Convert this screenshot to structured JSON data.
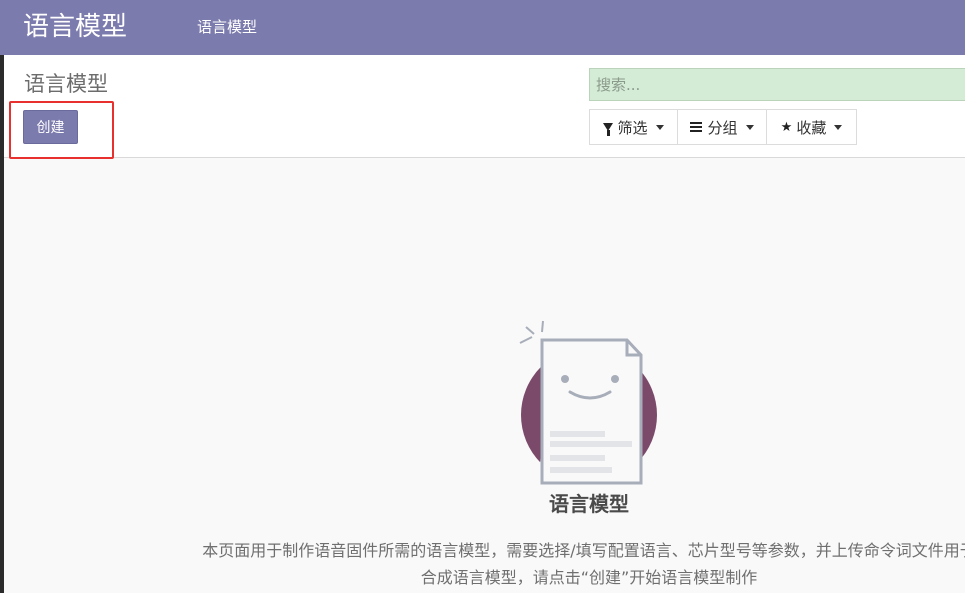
{
  "app": {
    "title": "语言模型",
    "top_menu_item": "语言模型"
  },
  "control_panel": {
    "breadcrumb": "语言模型",
    "create_label": "创建",
    "search_placeholder": "搜索..."
  },
  "search_options": {
    "filters_label": "筛选",
    "group_by_label": "分组",
    "favorites_label": "收藏"
  },
  "empty_state": {
    "title": "语言模型",
    "description": "本页面用于制作语音固件所需的语言模型，需要选择/填写配置语言、芯片型号等参数，并上传命令词文件用于合成语言模型，请点击“创建”开始语言模型制作"
  },
  "colors": {
    "brand": "#7c7bad",
    "search_bg": "#d4ecd6",
    "highlight": "#e8302f",
    "illustration_circle": "#7b4a6a"
  },
  "icons": {
    "filters": "funnel-icon",
    "group_by": "bars-icon",
    "favorites": "star-icon",
    "caret": "caret-down-icon"
  }
}
